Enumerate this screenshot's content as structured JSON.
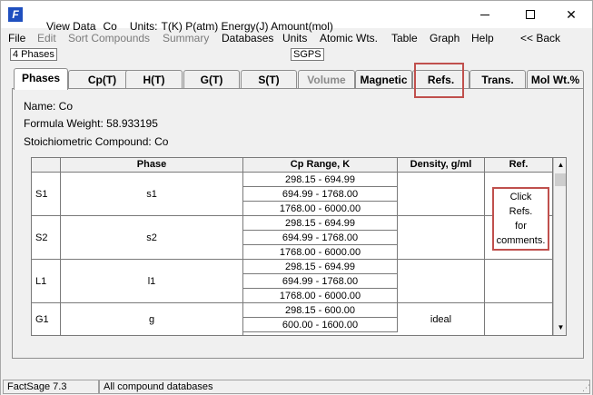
{
  "window": {
    "title_parts": [
      "View Data",
      "Co",
      "Units:",
      "T(K) P(atm) Energy(J) Amount(mol)"
    ],
    "app_icon_glyph": "F",
    "minimize_glyph": "",
    "close_glyph": "✕"
  },
  "menu": {
    "items": [
      {
        "label": "File",
        "enabled": true
      },
      {
        "label": "Edit",
        "enabled": false
      },
      {
        "label": "Sort Compounds",
        "enabled": false
      },
      {
        "label": "Summary",
        "enabled": false
      },
      {
        "label": "Databases",
        "enabled": true
      },
      {
        "label": "Units",
        "enabled": true
      },
      {
        "label": "Atomic Wts.",
        "enabled": true
      },
      {
        "label": "Table",
        "enabled": true
      },
      {
        "label": "Graph",
        "enabled": true
      },
      {
        "label": "Help",
        "enabled": true
      },
      {
        "label": "<< Back",
        "enabled": true
      }
    ]
  },
  "phase_count_label": "4 Phases",
  "database_label": "SGPS",
  "tabs": [
    {
      "label": "Phases",
      "active": true,
      "enabled": true
    },
    {
      "label": "Cp(T)",
      "active": false,
      "enabled": true
    },
    {
      "label": "H(T)",
      "active": false,
      "enabled": true
    },
    {
      "label": "G(T)",
      "active": false,
      "enabled": true
    },
    {
      "label": "S(T)",
      "active": false,
      "enabled": true
    },
    {
      "label": "Volume",
      "active": false,
      "enabled": false
    },
    {
      "label": "Magnetic",
      "active": false,
      "enabled": true
    },
    {
      "label": "Refs.",
      "active": false,
      "enabled": true
    },
    {
      "label": "Trans.",
      "active": false,
      "enabled": true
    },
    {
      "label": "Mol Wt.%",
      "active": false,
      "enabled": true
    }
  ],
  "info": {
    "name": "Name: Co",
    "formula_weight": "Formula Weight:  58.933195",
    "stoichiometric": "Stoichiometric Compound: Co"
  },
  "table": {
    "headers": [
      "",
      "Phase",
      "Cp Range, K",
      "Density, g/ml",
      "Ref."
    ],
    "rows": [
      {
        "id": "S1",
        "phase": "s1",
        "ranges": [
          "298.15 - 694.99",
          "694.99 - 1768.00",
          "1768.00 - 6000.00"
        ],
        "density": "",
        "ref": ""
      },
      {
        "id": "S2",
        "phase": "s2",
        "ranges": [
          "298.15 - 694.99",
          "694.99 - 1768.00",
          "1768.00 - 6000.00"
        ],
        "density": "",
        "ref": ""
      },
      {
        "id": "L1",
        "phase": "l1",
        "ranges": [
          "298.15 - 694.99",
          "694.99 - 1768.00",
          "1768.00 - 6000.00"
        ],
        "density": "",
        "ref": ""
      },
      {
        "id": "G1",
        "phase": "g",
        "ranges": [
          "298.15 - 600.00",
          "600.00 - 1600.00"
        ],
        "density": "ideal",
        "ref": ""
      }
    ],
    "scroll_up_glyph": "▲",
    "scroll_down_glyph": "▼"
  },
  "refs_note": [
    "Click",
    "Refs.",
    "for",
    "comments."
  ],
  "status": {
    "version": "FactSage 7.3",
    "databases": "All compound databases"
  },
  "colors": {
    "highlight": "#c0504d",
    "app_icon": "#1f4fbf",
    "disabled_text": "#7a7a7a"
  }
}
